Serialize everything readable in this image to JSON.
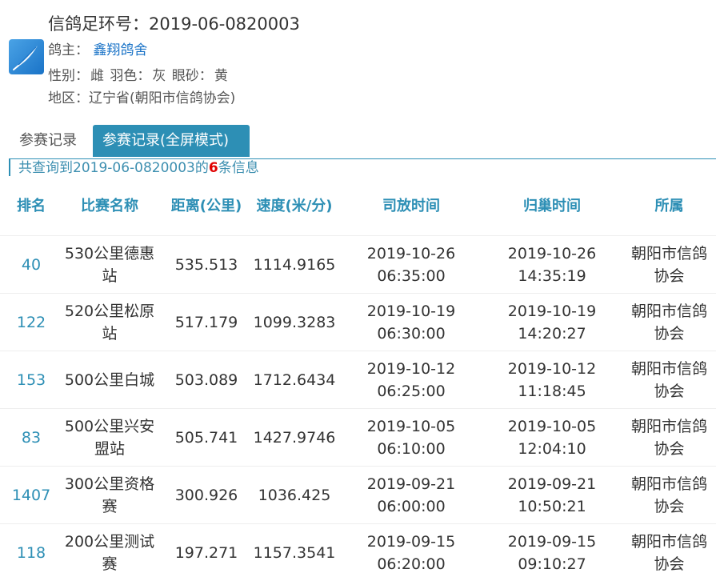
{
  "header": {
    "title": "信鸽足环号：2019-06-0820003",
    "owner_label": "鸽主：",
    "owner_name": "鑫翔鸽舍",
    "gender_label": "性别：",
    "gender_value": "雌",
    "feather_label": "羽色：",
    "feather_value": "灰",
    "eye_label": "眼砂：",
    "eye_value": "黄",
    "region_label": "地区：",
    "region_value": "辽宁省(朝阳市信鸽协会)"
  },
  "logo": {
    "icon": "feather-logo-icon",
    "color": "#1a73c7"
  },
  "tabs": [
    {
      "label": "参赛记录"
    },
    {
      "label": "参赛记录(全屏模式)"
    }
  ],
  "summary": {
    "prefix": "共查询到2019-06-0820003的",
    "count": "6",
    "suffix": "条信息"
  },
  "table": {
    "columns": [
      "排名",
      "比赛名称",
      "距离(公里)",
      "速度(米/分)",
      "司放时间",
      "归巢时间",
      "所属"
    ],
    "rows": [
      {
        "rank": "40",
        "race": "530公里德惠站",
        "distance": "535.513",
        "speed": "1114.9165",
        "release": "2019-10-26 06:35:00",
        "arrival": "2019-10-26 14:35:19",
        "org": "朝阳市信鸽协会"
      },
      {
        "rank": "122",
        "race": "520公里松原站",
        "distance": "517.179",
        "speed": "1099.3283",
        "release": "2019-10-19 06:30:00",
        "arrival": "2019-10-19 14:20:27",
        "org": "朝阳市信鸽协会"
      },
      {
        "rank": "153",
        "race": "500公里白城",
        "distance": "503.089",
        "speed": "1712.6434",
        "release": "2019-10-12 06:25:00",
        "arrival": "2019-10-12 11:18:45",
        "org": "朝阳市信鸽协会"
      },
      {
        "rank": "83",
        "race": "500公里兴安盟站",
        "distance": "505.741",
        "speed": "1427.9746",
        "release": "2019-10-05 06:10:00",
        "arrival": "2019-10-05 12:04:10",
        "org": "朝阳市信鸽协会"
      },
      {
        "rank": "1407",
        "race": "300公里资格赛",
        "distance": "300.926",
        "speed": "1036.425",
        "release": "2019-09-21 06:00:00",
        "arrival": "2019-09-21 10:50:21",
        "org": "朝阳市信鸽协会"
      },
      {
        "rank": "118",
        "race": "200公里测试赛",
        "distance": "197.271",
        "speed": "1157.3541",
        "release": "2019-09-15 06:20:00",
        "arrival": "2019-09-15 09:10:27",
        "org": "朝阳市信鸽协会"
      }
    ]
  },
  "colors": {
    "accent": "#2d8fb5",
    "link": "#1a73c7",
    "count": "#e00000"
  }
}
